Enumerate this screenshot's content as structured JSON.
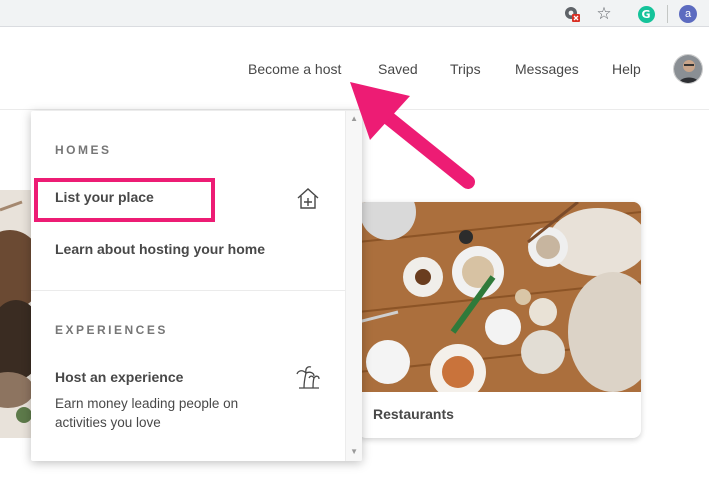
{
  "browser": {
    "extension_icon": "blocked-extension-icon",
    "bookmark_icon": "star-icon",
    "grammarly_letter": "G",
    "profile_letter": "a"
  },
  "header": {
    "nav": {
      "become_host": "Become a host",
      "saved": "Saved",
      "trips": "Trips",
      "messages": "Messages",
      "help": "Help"
    },
    "avatar_icon": "user-avatar"
  },
  "dropdown": {
    "homes_heading": "HOMES",
    "list_your_place": "List your place",
    "learn_hosting": "Learn about hosting your home",
    "experiences_heading": "EXPERIENCES",
    "host_experience": "Host an experience",
    "host_experience_sub": "Earn money leading people on activities you love",
    "house_icon": "house-plus-icon",
    "palm_icon": "palm-trees-icon"
  },
  "cards": {
    "restaurants_label": "Restaurants"
  },
  "colors": {
    "annotation": "#ed1c74",
    "grammarly": "#15c39a",
    "profile": "#5c6bc0"
  }
}
